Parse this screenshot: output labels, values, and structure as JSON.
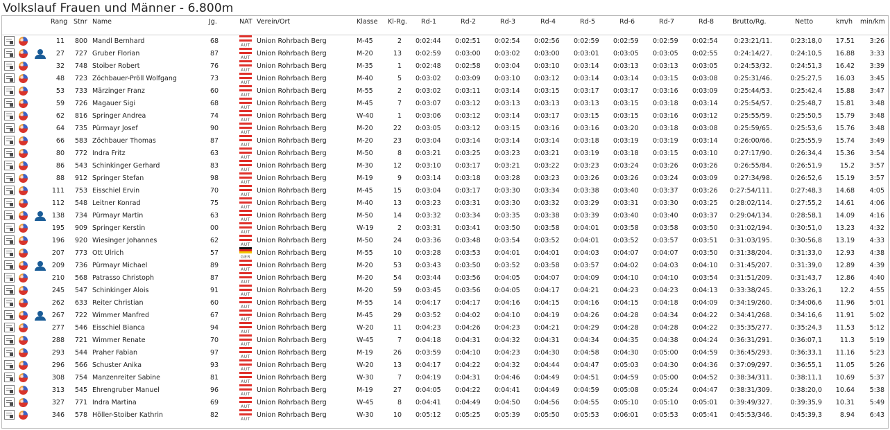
{
  "title": "Volkslauf Frauen und Männer - 6.800m",
  "headers": {
    "rang": "Rang",
    "stnr": "Stnr",
    "name": "Name",
    "jg": "Jg.",
    "nat": "NAT",
    "verein": "Verein/Ort",
    "klasse": "Klasse",
    "klrg": "Kl-Rg.",
    "rd1": "Rd-1",
    "rd2": "Rd-2",
    "rd3": "Rd-3",
    "rd4": "Rd-4",
    "rd5": "Rd-5",
    "rd6": "Rd-6",
    "rd7": "Rd-7",
    "rd8": "Rd-8",
    "brutto": "Brutto/Rg.",
    "netto": "Netto",
    "kmh": "km/h",
    "minkm": "min/km"
  },
  "colors": {
    "aut_red": "#e0302a",
    "ger_black": "#111111",
    "ger_red": "#dd2222",
    "ger_gold": "#f2c500"
  },
  "icons": {
    "doc": "certificate-icon",
    "ball": "result-details-icon",
    "person": "person-icon"
  },
  "rows": [
    {
      "rang": "11",
      "stnr": "800",
      "name": "Mandl Bernhard",
      "jg": "68",
      "nat": "AUT",
      "verein": "Union Rohrbach Berg",
      "klasse": "M-45",
      "klrg": "2",
      "rd": [
        "0:02:44",
        "0:02:51",
        "0:02:54",
        "0:02:56",
        "0:02:59",
        "0:02:59",
        "0:02:59",
        "0:02:54"
      ],
      "brutto": "0:23:21/11.",
      "netto": "0:23:18,0",
      "kmh": "17.51",
      "minkm": "3:26",
      "person": false
    },
    {
      "rang": "27",
      "stnr": "727",
      "name": "Gruber Florian",
      "jg": "87",
      "nat": "AUT",
      "verein": "Union Rohrbach Berg",
      "klasse": "M-20",
      "klrg": "13",
      "rd": [
        "0:02:59",
        "0:03:00",
        "0:03:02",
        "0:03:00",
        "0:03:01",
        "0:03:05",
        "0:03:05",
        "0:02:55"
      ],
      "brutto": "0:24:14/27.",
      "netto": "0:24:10,5",
      "kmh": "16.88",
      "minkm": "3:33",
      "person": true
    },
    {
      "rang": "32",
      "stnr": "748",
      "name": "Stoiber Robert",
      "jg": "76",
      "nat": "AUT",
      "verein": "Union Rohrbach Berg",
      "klasse": "M-35",
      "klrg": "1",
      "rd": [
        "0:02:48",
        "0:02:58",
        "0:03:04",
        "0:03:10",
        "0:03:14",
        "0:03:13",
        "0:03:13",
        "0:03:05"
      ],
      "brutto": "0:24:53/32.",
      "netto": "0:24:51,3",
      "kmh": "16.42",
      "minkm": "3:39",
      "person": false
    },
    {
      "rang": "48",
      "stnr": "723",
      "name": "Zöchbauer-Pröll Wolfgang",
      "jg": "73",
      "nat": "AUT",
      "verein": "Union Rohrbach Berg",
      "klasse": "M-40",
      "klrg": "5",
      "rd": [
        "0:03:02",
        "0:03:09",
        "0:03:10",
        "0:03:12",
        "0:03:14",
        "0:03:14",
        "0:03:15",
        "0:03:08"
      ],
      "brutto": "0:25:31/46.",
      "netto": "0:25:27,5",
      "kmh": "16.03",
      "minkm": "3:45",
      "person": false
    },
    {
      "rang": "53",
      "stnr": "733",
      "name": "Märzinger Franz",
      "jg": "60",
      "nat": "AUT",
      "verein": "Union Rohrbach Berg",
      "klasse": "M-55",
      "klrg": "2",
      "rd": [
        "0:03:02",
        "0:03:11",
        "0:03:14",
        "0:03:15",
        "0:03:17",
        "0:03:17",
        "0:03:16",
        "0:03:09"
      ],
      "brutto": "0:25:44/53.",
      "netto": "0:25:42,4",
      "kmh": "15.88",
      "minkm": "3:47",
      "person": false
    },
    {
      "rang": "59",
      "stnr": "726",
      "name": "Magauer Sigi",
      "jg": "68",
      "nat": "AUT",
      "verein": "Union Rohrbach Berg",
      "klasse": "M-45",
      "klrg": "7",
      "rd": [
        "0:03:07",
        "0:03:12",
        "0:03:13",
        "0:03:13",
        "0:03:13",
        "0:03:15",
        "0:03:18",
        "0:03:14"
      ],
      "brutto": "0:25:54/57.",
      "netto": "0:25:48,7",
      "kmh": "15.81",
      "minkm": "3:48",
      "person": false
    },
    {
      "rang": "62",
      "stnr": "816",
      "name": "Springer Andrea",
      "jg": "74",
      "nat": "AUT",
      "verein": "Union Rohrbach Berg",
      "klasse": "W-40",
      "klrg": "1",
      "rd": [
        "0:03:06",
        "0:03:12",
        "0:03:14",
        "0:03:17",
        "0:03:15",
        "0:03:15",
        "0:03:16",
        "0:03:12"
      ],
      "brutto": "0:25:55/59.",
      "netto": "0:25:50,5",
      "kmh": "15.79",
      "minkm": "3:48",
      "person": false
    },
    {
      "rang": "64",
      "stnr": "735",
      "name": "Pürmayr Josef",
      "jg": "90",
      "nat": "AUT",
      "verein": "Union Rohrbach Berg",
      "klasse": "M-20",
      "klrg": "22",
      "rd": [
        "0:03:05",
        "0:03:12",
        "0:03:15",
        "0:03:16",
        "0:03:16",
        "0:03:20",
        "0:03:18",
        "0:03:08"
      ],
      "brutto": "0:25:59/65.",
      "netto": "0:25:53,6",
      "kmh": "15.76",
      "minkm": "3:48",
      "person": false
    },
    {
      "rang": "66",
      "stnr": "583",
      "name": "Zöchbauer Thomas",
      "jg": "87",
      "nat": "AUT",
      "verein": "Union Rohrbach Berg",
      "klasse": "M-20",
      "klrg": "23",
      "rd": [
        "0:03:04",
        "0:03:14",
        "0:03:14",
        "0:03:14",
        "0:03:18",
        "0:03:19",
        "0:03:19",
        "0:03:14"
      ],
      "brutto": "0:26:00/66.",
      "netto": "0:25:55,9",
      "kmh": "15.74",
      "minkm": "3:49",
      "person": false
    },
    {
      "rang": "80",
      "stnr": "772",
      "name": "Indra Fritz",
      "jg": "63",
      "nat": "AUT",
      "verein": "Union Rohrbach Berg",
      "klasse": "M-50",
      "klrg": "8",
      "rd": [
        "0:03:21",
        "0:03:25",
        "0:03:23",
        "0:03:21",
        "0:03:19",
        "0:03:18",
        "0:03:15",
        "0:03:10"
      ],
      "brutto": "0:27:17/90.",
      "netto": "0:26:34,4",
      "kmh": "15.36",
      "minkm": "3:54",
      "person": false
    },
    {
      "rang": "86",
      "stnr": "543",
      "name": "Schinkinger Gerhard",
      "jg": "83",
      "nat": "AUT",
      "verein": "Union Rohrbach Berg",
      "klasse": "M-30",
      "klrg": "12",
      "rd": [
        "0:03:10",
        "0:03:17",
        "0:03:21",
        "0:03:22",
        "0:03:23",
        "0:03:24",
        "0:03:26",
        "0:03:26"
      ],
      "brutto": "0:26:55/84.",
      "netto": "0:26:51,9",
      "kmh": "15.2",
      "minkm": "3:57",
      "person": false
    },
    {
      "rang": "88",
      "stnr": "912",
      "name": "Springer Stefan",
      "jg": "98",
      "nat": "AUT",
      "verein": "Union Rohrbach Berg",
      "klasse": "M-19",
      "klrg": "9",
      "rd": [
        "0:03:14",
        "0:03:18",
        "0:03:28",
        "0:03:23",
        "0:03:26",
        "0:03:26",
        "0:03:24",
        "0:03:09"
      ],
      "brutto": "0:27:34/98.",
      "netto": "0:26:52,6",
      "kmh": "15.19",
      "minkm": "3:57",
      "person": false
    },
    {
      "rang": "111",
      "stnr": "753",
      "name": "Eisschiel Ervin",
      "jg": "70",
      "nat": "AUT",
      "verein": "Union Rohrbach Berg",
      "klasse": "M-45",
      "klrg": "15",
      "rd": [
        "0:03:04",
        "0:03:17",
        "0:03:30",
        "0:03:34",
        "0:03:38",
        "0:03:40",
        "0:03:37",
        "0:03:26"
      ],
      "brutto": "0:27:54/111.",
      "netto": "0:27:48,3",
      "kmh": "14.68",
      "minkm": "4:05",
      "person": false
    },
    {
      "rang": "112",
      "stnr": "548",
      "name": "Leitner Konrad",
      "jg": "75",
      "nat": "AUT",
      "verein": "Union Rohrbach Berg",
      "klasse": "M-40",
      "klrg": "13",
      "rd": [
        "0:03:23",
        "0:03:31",
        "0:03:30",
        "0:03:32",
        "0:03:29",
        "0:03:31",
        "0:03:30",
        "0:03:25"
      ],
      "brutto": "0:28:02/114.",
      "netto": "0:27:55,2",
      "kmh": "14.61",
      "minkm": "4:06",
      "person": false
    },
    {
      "rang": "138",
      "stnr": "734",
      "name": "Pürmayr Martin",
      "jg": "63",
      "nat": "AUT",
      "verein": "Union Rohrbach Berg",
      "klasse": "M-50",
      "klrg": "14",
      "rd": [
        "0:03:32",
        "0:03:34",
        "0:03:35",
        "0:03:38",
        "0:03:39",
        "0:03:40",
        "0:03:40",
        "0:03:37"
      ],
      "brutto": "0:29:04/134.",
      "netto": "0:28:58,1",
      "kmh": "14.09",
      "minkm": "4:16",
      "person": true
    },
    {
      "rang": "195",
      "stnr": "909",
      "name": "Springer Kerstin",
      "jg": "00",
      "nat": "AUT",
      "verein": "Union Rohrbach Berg",
      "klasse": "W-19",
      "klrg": "2",
      "rd": [
        "0:03:31",
        "0:03:41",
        "0:03:50",
        "0:03:58",
        "0:04:01",
        "0:03:58",
        "0:03:58",
        "0:03:50"
      ],
      "brutto": "0:31:02/194.",
      "netto": "0:30:51,0",
      "kmh": "13.23",
      "minkm": "4:32",
      "person": false
    },
    {
      "rang": "196",
      "stnr": "920",
      "name": "Wiesinger Johannes",
      "jg": "62",
      "nat": "AUT",
      "verein": "Union Rohrbach Berg",
      "klasse": "M-50",
      "klrg": "24",
      "rd": [
        "0:03:36",
        "0:03:48",
        "0:03:54",
        "0:03:52",
        "0:04:01",
        "0:03:52",
        "0:03:57",
        "0:03:51"
      ],
      "brutto": "0:31:03/195.",
      "netto": "0:30:56,8",
      "kmh": "13.19",
      "minkm": "4:33",
      "person": false
    },
    {
      "rang": "207",
      "stnr": "773",
      "name": "Ott Ulrich",
      "jg": "57",
      "nat": "GER",
      "verein": "Union Rohrbach Berg",
      "klasse": "M-55",
      "klrg": "10",
      "rd": [
        "0:03:28",
        "0:03:53",
        "0:04:01",
        "0:04:01",
        "0:04:03",
        "0:04:07",
        "0:04:07",
        "0:03:50"
      ],
      "brutto": "0:31:38/204.",
      "netto": "0:31:33,0",
      "kmh": "12.93",
      "minkm": "4:38",
      "person": false
    },
    {
      "rang": "209",
      "stnr": "736",
      "name": "Pürmayr Michael",
      "jg": "89",
      "nat": "AUT",
      "verein": "Union Rohrbach Berg",
      "klasse": "M-20",
      "klrg": "53",
      "rd": [
        "0:03:43",
        "0:03:50",
        "0:03:52",
        "0:03:58",
        "0:03:57",
        "0:04:02",
        "0:04:03",
        "0:04:10"
      ],
      "brutto": "0:31:45/207.",
      "netto": "0:31:39,0",
      "kmh": "12.89",
      "minkm": "4:39",
      "person": true
    },
    {
      "rang": "210",
      "stnr": "568",
      "name": "Patrasso Christoph",
      "jg": "87",
      "nat": "AUT",
      "verein": "Union Rohrbach Berg",
      "klasse": "M-20",
      "klrg": "54",
      "rd": [
        "0:03:44",
        "0:03:56",
        "0:04:05",
        "0:04:07",
        "0:04:09",
        "0:04:10",
        "0:04:10",
        "0:03:54"
      ],
      "brutto": "0:31:51/209.",
      "netto": "0:31:43,7",
      "kmh": "12.86",
      "minkm": "4:40",
      "person": false
    },
    {
      "rang": "245",
      "stnr": "547",
      "name": "Schinkinger Alois",
      "jg": "91",
      "nat": "AUT",
      "verein": "Union Rohrbach Berg",
      "klasse": "M-20",
      "klrg": "59",
      "rd": [
        "0:03:45",
        "0:03:56",
        "0:04:05",
        "0:04:17",
        "0:04:21",
        "0:04:23",
        "0:04:23",
        "0:04:13"
      ],
      "brutto": "0:33:38/245.",
      "netto": "0:33:26,1",
      "kmh": "12.2",
      "minkm": "4:55",
      "person": false
    },
    {
      "rang": "262",
      "stnr": "633",
      "name": "Reiter Christian",
      "jg": "60",
      "nat": "AUT",
      "verein": "Union Rohrbach Berg",
      "klasse": "M-55",
      "klrg": "14",
      "rd": [
        "0:04:17",
        "0:04:17",
        "0:04:16",
        "0:04:15",
        "0:04:16",
        "0:04:15",
        "0:04:18",
        "0:04:09"
      ],
      "brutto": "0:34:19/260.",
      "netto": "0:34:06,6",
      "kmh": "11.96",
      "minkm": "5:01",
      "person": false
    },
    {
      "rang": "267",
      "stnr": "722",
      "name": "Wimmer Manfred",
      "jg": "67",
      "nat": "AUT",
      "verein": "Union Rohrbach Berg",
      "klasse": "M-45",
      "klrg": "29",
      "rd": [
        "0:03:52",
        "0:04:02",
        "0:04:10",
        "0:04:19",
        "0:04:26",
        "0:04:28",
        "0:04:34",
        "0:04:22"
      ],
      "brutto": "0:34:41/268.",
      "netto": "0:34:16,6",
      "kmh": "11.91",
      "minkm": "5:02",
      "person": true
    },
    {
      "rang": "277",
      "stnr": "546",
      "name": "Eisschiel Bianca",
      "jg": "94",
      "nat": "AUT",
      "verein": "Union Rohrbach Berg",
      "klasse": "W-20",
      "klrg": "11",
      "rd": [
        "0:04:23",
        "0:04:26",
        "0:04:23",
        "0:04:21",
        "0:04:29",
        "0:04:28",
        "0:04:28",
        "0:04:22"
      ],
      "brutto": "0:35:35/277.",
      "netto": "0:35:24,3",
      "kmh": "11.53",
      "minkm": "5:12",
      "person": false
    },
    {
      "rang": "288",
      "stnr": "721",
      "name": "Wimmer Renate",
      "jg": "70",
      "nat": "AUT",
      "verein": "Union Rohrbach Berg",
      "klasse": "W-45",
      "klrg": "7",
      "rd": [
        "0:04:18",
        "0:04:31",
        "0:04:32",
        "0:04:31",
        "0:04:34",
        "0:04:35",
        "0:04:38",
        "0:04:24"
      ],
      "brutto": "0:36:31/291.",
      "netto": "0:36:07,1",
      "kmh": "11.3",
      "minkm": "5:19",
      "person": false
    },
    {
      "rang": "293",
      "stnr": "544",
      "name": "Praher Fabian",
      "jg": "97",
      "nat": "AUT",
      "verein": "Union Rohrbach Berg",
      "klasse": "M-19",
      "klrg": "26",
      "rd": [
        "0:03:59",
        "0:04:10",
        "0:04:23",
        "0:04:30",
        "0:04:58",
        "0:04:30",
        "0:05:00",
        "0:04:59"
      ],
      "brutto": "0:36:45/293.",
      "netto": "0:36:33,1",
      "kmh": "11.16",
      "minkm": "5:23",
      "person": false
    },
    {
      "rang": "296",
      "stnr": "566",
      "name": "Schuster Anika",
      "jg": "93",
      "nat": "AUT",
      "verein": "Union Rohrbach Berg",
      "klasse": "W-20",
      "klrg": "13",
      "rd": [
        "0:04:17",
        "0:04:22",
        "0:04:32",
        "0:04:44",
        "0:04:47",
        "0:05:03",
        "0:04:30",
        "0:04:36"
      ],
      "brutto": "0:37:09/297.",
      "netto": "0:36:55,1",
      "kmh": "11.05",
      "minkm": "5:26",
      "person": false
    },
    {
      "rang": "308",
      "stnr": "754",
      "name": "Manzenreiter Sabine",
      "jg": "81",
      "nat": "AUT",
      "verein": "Union Rohrbach Berg",
      "klasse": "W-30",
      "klrg": "7",
      "rd": [
        "0:04:19",
        "0:04:31",
        "0:04:46",
        "0:04:49",
        "0:04:51",
        "0:04:59",
        "0:05:00",
        "0:04:52"
      ],
      "brutto": "0:38:34/311.",
      "netto": "0:38:11,1",
      "kmh": "10.69",
      "minkm": "5:37",
      "person": false
    },
    {
      "rang": "313",
      "stnr": "545",
      "name": "Ehrengruber Manuel",
      "jg": "96",
      "nat": "AUT",
      "verein": "Union Rohrbach Berg",
      "klasse": "M-19",
      "klrg": "27",
      "rd": [
        "0:04:05",
        "0:04:22",
        "0:04:41",
        "0:04:49",
        "0:04:59",
        "0:05:08",
        "0:05:24",
        "0:04:47"
      ],
      "brutto": "0:38:31/309.",
      "netto": "0:38:20,0",
      "kmh": "10.64",
      "minkm": "5:38",
      "person": false
    },
    {
      "rang": "327",
      "stnr": "771",
      "name": "Indra Martina",
      "jg": "69",
      "nat": "AUT",
      "verein": "Union Rohrbach Berg",
      "klasse": "W-45",
      "klrg": "8",
      "rd": [
        "0:04:41",
        "0:04:49",
        "0:04:50",
        "0:04:56",
        "0:04:55",
        "0:05:10",
        "0:05:10",
        "0:05:01"
      ],
      "brutto": "0:39:49/327.",
      "netto": "0:39:35,9",
      "kmh": "10.31",
      "minkm": "5:49",
      "person": false
    },
    {
      "rang": "346",
      "stnr": "578",
      "name": "Höller-Stoiber Kathrin",
      "jg": "82",
      "nat": "AUT",
      "verein": "Union Rohrbach Berg",
      "klasse": "W-30",
      "klrg": "10",
      "rd": [
        "0:05:12",
        "0:05:25",
        "0:05:39",
        "0:05:50",
        "0:05:53",
        "0:06:01",
        "0:05:53",
        "0:05:41"
      ],
      "brutto": "0:45:53/346.",
      "netto": "0:45:39,3",
      "kmh": "8.94",
      "minkm": "6:43",
      "person": false
    }
  ]
}
